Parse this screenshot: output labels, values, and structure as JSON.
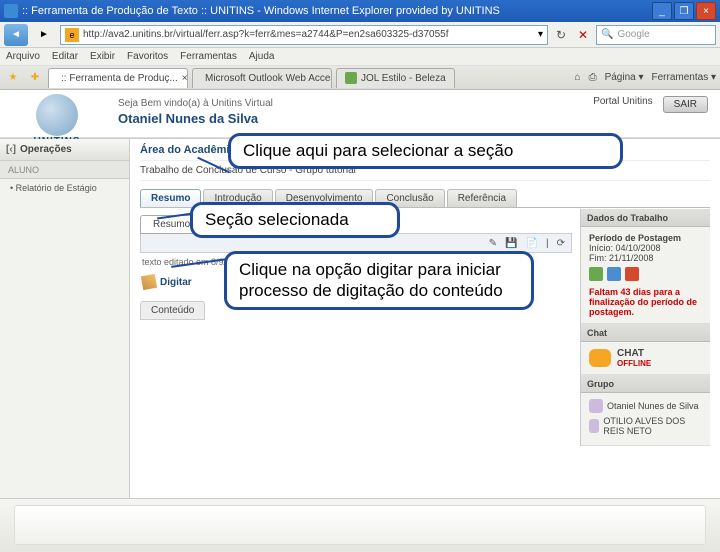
{
  "window": {
    "title": ":: Ferramenta de Produção de Texto :: UNITINS - Windows Internet Explorer provided by UNITINS",
    "min": "_",
    "max": "❐",
    "close": "×"
  },
  "addressbar": {
    "url": "http://ava2.unitins.br/virtual/ferr.asp?k=ferr&mes=a2744&P=en2sa603325-d37055f",
    "search_placeholder": "Google"
  },
  "menubar": [
    "Arquivo",
    "Editar",
    "Exibir",
    "Favoritos",
    "Ferramentas",
    "Ajuda"
  ],
  "tabs": [
    {
      "label": ":: Ferramenta de Produç...",
      "active": true
    },
    {
      "label": "Microsoft Outlook Web Access",
      "active": false
    },
    {
      "label": "JOL Estilo - Beleza",
      "active": false
    }
  ],
  "toolbar_right": {
    "pagina": "Página ▾",
    "ferramentas": "Ferramentas ▾",
    "home": "⌂",
    "print": "⎙"
  },
  "header": {
    "logo": "UNITINS",
    "welcome": "Seja Bem vindo(a) à Unitins Virtual",
    "user": "Otaniel Nunes da Silva",
    "portal": "Portal Unitins",
    "sair": "SAIR"
  },
  "sidebar": {
    "title": "Operações",
    "subtitle": "ALUNO",
    "item1": "• Relatório de Estágio"
  },
  "content": {
    "area": "Área do Acadêmico",
    "crumb": "Trabalho de Conclusão de Curso - Grupo tutorial",
    "sections": [
      "Resumo",
      "Introdução",
      "Desenvolvimento",
      "Conclusão",
      "Referência"
    ],
    "active_section": "Resumo",
    "meta": "texto editado em 8/9/2008 18:04 hs por Otaniel Nunes da Silva",
    "digitar": "Digitar",
    "conteudo": "Conteúdo"
  },
  "rightcol": {
    "dados_title": "Dados do Trabalho",
    "periodo": "Período de Postagem",
    "inicio": "Início: 04/10/2008",
    "fim": "Fim: 21/11/2008",
    "faltam": "Faltam 43 dias para a finalização do período de postagem.",
    "chat_title": "Chat",
    "chat_label": "CHAT",
    "chat_status": "OFFLINE",
    "grupo_title": "Grupo",
    "members": [
      "Otaniel Nunes de Silva",
      "OTILIO ALVES DOS REIS NETO"
    ]
  },
  "callouts": {
    "c1": "Clique aqui para selecionar a seção",
    "c2": "Seção selecionada",
    "c3": "Clique na opção digitar para iniciar processo de digitação do conteúdo"
  }
}
